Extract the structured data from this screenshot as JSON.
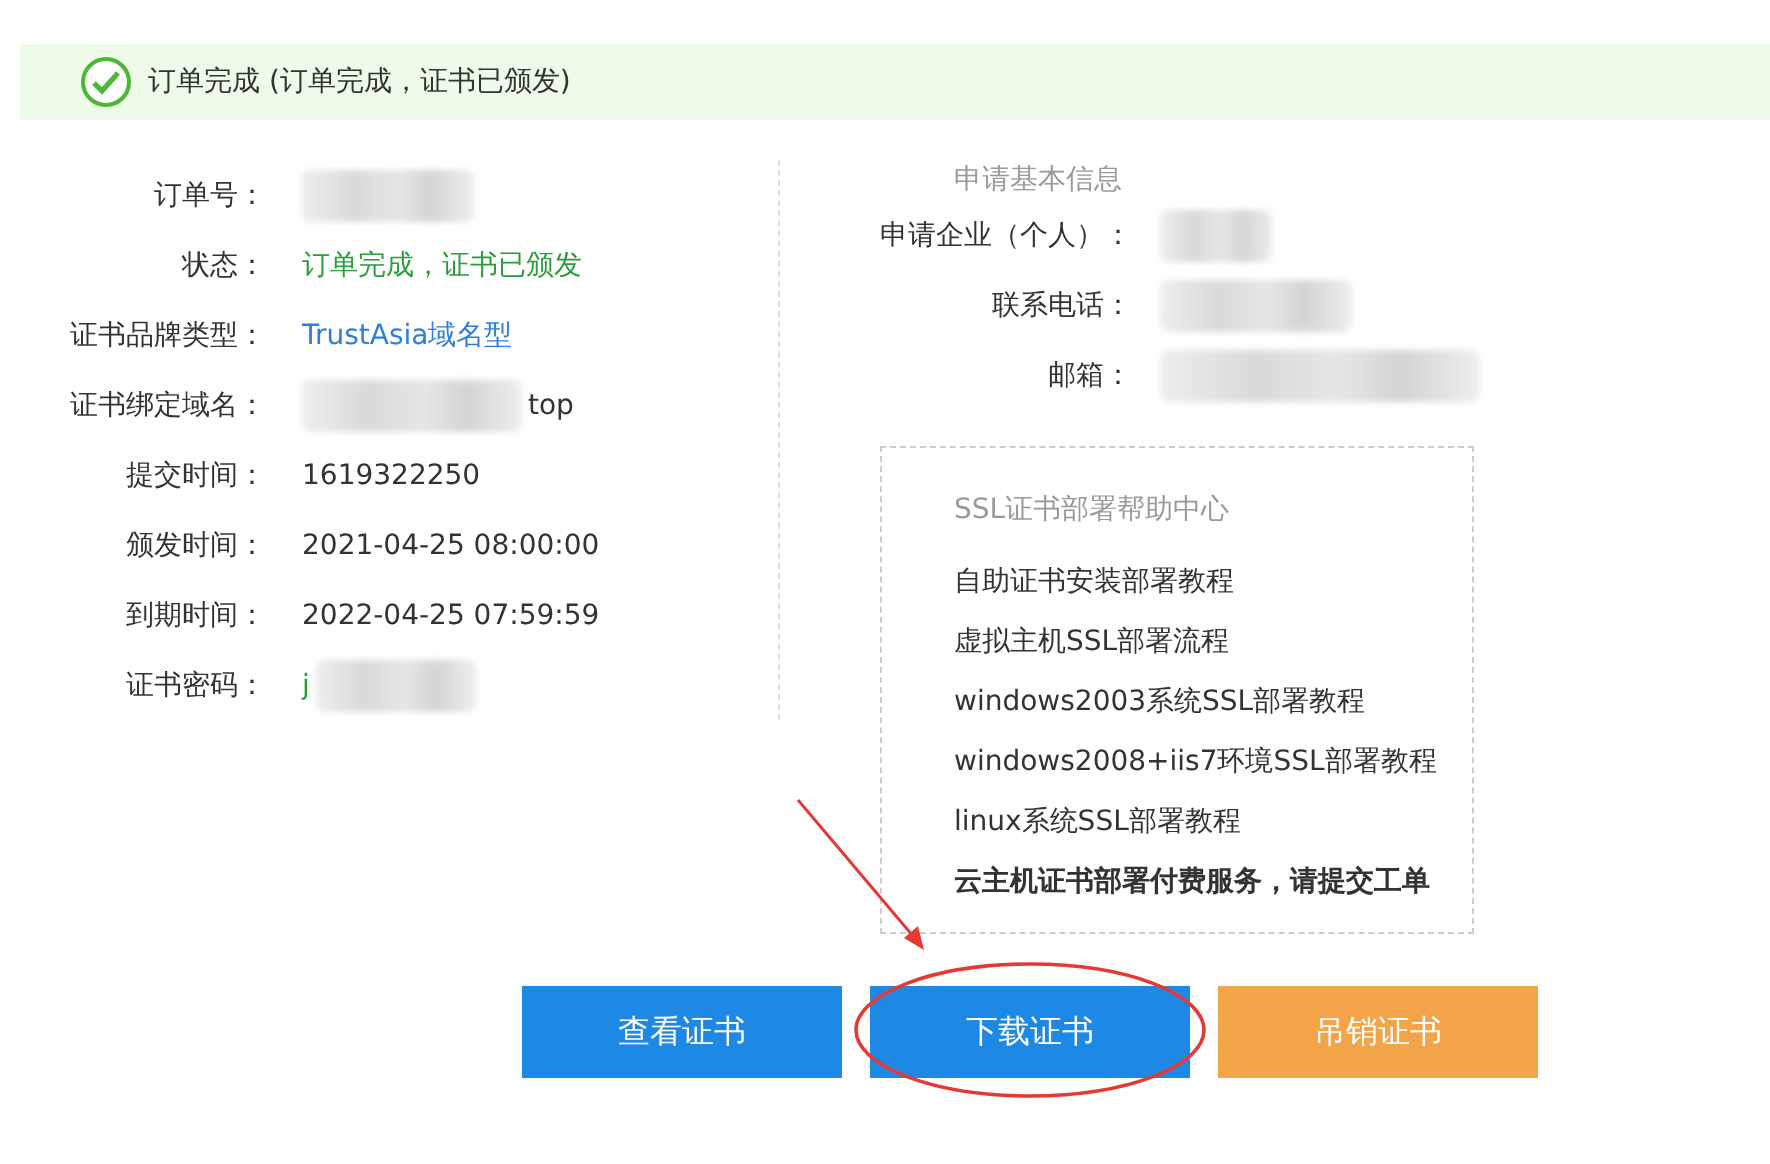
{
  "banner": {
    "text": "订单完成 (订单完成，证书已颁发)"
  },
  "order_fields": [
    {
      "label": "订单号：",
      "kind": "redacted"
    },
    {
      "label": "状态：",
      "value": "订单完成，证书已颁发",
      "kind": "status"
    },
    {
      "label": "证书品牌类型：",
      "value": "TrustAsia域名型",
      "kind": "link"
    },
    {
      "label": "证书绑定域名：",
      "value": "top",
      "kind": "masked_prefix"
    },
    {
      "label": "提交时间：",
      "value": "1619322250",
      "kind": "text"
    },
    {
      "label": "颁发时间：",
      "value": "2021-04-25 08:00:00",
      "kind": "text"
    },
    {
      "label": "到期时间：",
      "value": "2022-04-25 07:59:59",
      "kind": "text"
    },
    {
      "label": "证书密码：",
      "value": "j",
      "kind": "masked_suffix"
    }
  ],
  "applicant": {
    "title": "申请基本信息",
    "fields": [
      {
        "label": "申请企业（个人）：",
        "kind": "redacted"
      },
      {
        "label": "联系电话：",
        "kind": "redacted"
      },
      {
        "label": "邮箱：",
        "kind": "redacted"
      }
    ]
  },
  "help_center": {
    "title": "SSL证书部署帮助中心",
    "links": [
      {
        "text": "自助证书安装部署教程",
        "emphasis": false
      },
      {
        "text": "虚拟主机SSL部署流程",
        "emphasis": false
      },
      {
        "text": "windows2003系统SSL部署教程",
        "emphasis": false
      },
      {
        "text": "windows2008+iis7环境SSL部署教程",
        "emphasis": false
      },
      {
        "text": "linux系统SSL部署教程",
        "emphasis": false
      },
      {
        "text": "云主机证书部署付费服务，请提交工单",
        "emphasis": true
      }
    ]
  },
  "buttons": [
    {
      "label": "查看证书",
      "kind": "primary",
      "highlighted": false
    },
    {
      "label": "下载证书",
      "kind": "primary",
      "highlighted": true
    },
    {
      "label": "吊销证书",
      "kind": "warning",
      "highlighted": false
    }
  ]
}
